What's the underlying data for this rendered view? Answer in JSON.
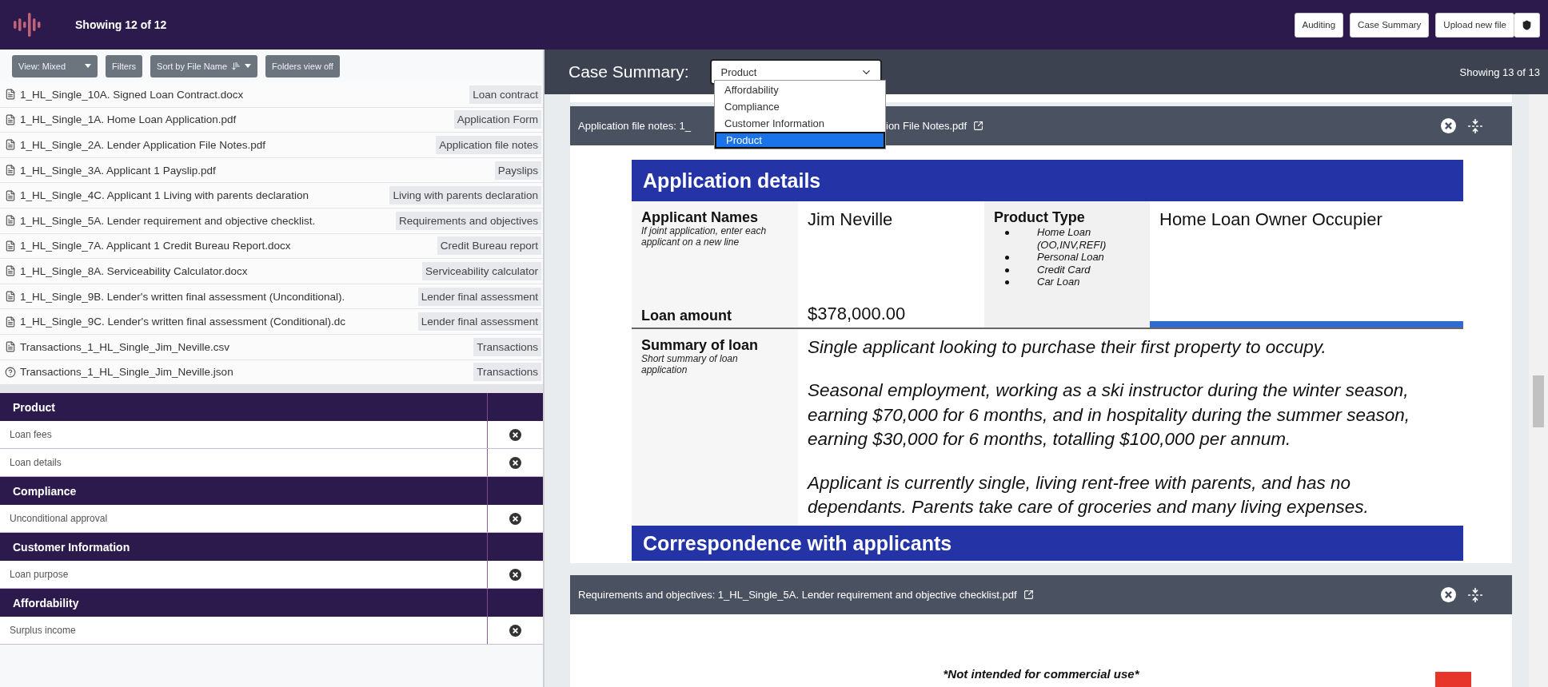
{
  "app_bar": {
    "showing": "Showing 12 of 12",
    "buttons": [
      "Auditing",
      "Case Summary",
      "Upload new file"
    ]
  },
  "toolbar": [
    {
      "label": "View: Mixed",
      "kind": "dropdown"
    },
    {
      "label": "Filters",
      "kind": "button"
    },
    {
      "label": "Sort by File Name",
      "kind": "sort"
    },
    {
      "label": "Folders view off",
      "kind": "button"
    }
  ],
  "files": [
    {
      "name": "1_HL_Single_10A. Signed Loan Contract.docx",
      "kind": "file",
      "tag": "Loan contract"
    },
    {
      "name": "1_HL_Single_1A. Home Loan Application.pdf",
      "kind": "file",
      "tag": "Application Form"
    },
    {
      "name": "1_HL_Single_2A. Lender Application File Notes.pdf",
      "kind": "file",
      "tag": "Application file notes"
    },
    {
      "name": "1_HL_Single_3A. Applicant 1 Payslip.pdf",
      "kind": "file",
      "tag": "Payslips"
    },
    {
      "name": "1_HL_Single_4C. Applicant 1 Living with parents declaration",
      "kind": "file",
      "tag": "Living with parents declaration"
    },
    {
      "name": "1_HL_Single_5A. Lender requirement and objective checklist.",
      "kind": "file",
      "tag": "Requirements and objectives"
    },
    {
      "name": "1_HL_Single_7A. Applicant 1 Credit Bureau Report.docx",
      "kind": "file",
      "tag": "Credit Bureau report"
    },
    {
      "name": "1_HL_Single_8A. Serviceability Calculator.docx",
      "kind": "file",
      "tag": "Serviceability calculator"
    },
    {
      "name": "1_HL_Single_9B. Lender's written final assessment (Unconditional).",
      "kind": "file",
      "tag": "Lender final assessment"
    },
    {
      "name": "1_HL_Single_9C. Lender's written final assessment (Conditional).dc",
      "kind": "file",
      "tag": "Lender final assessment"
    },
    {
      "name": "Transactions_1_HL_Single_Jim_Neville.csv",
      "kind": "file",
      "tag": "Transactions"
    },
    {
      "name": "Transactions_1_HL_Single_Jim_Neville.json",
      "kind": "unknown",
      "tag": "Transactions"
    }
  ],
  "categories": [
    {
      "name": "Product",
      "items": [
        "Loan fees",
        "Loan details"
      ]
    },
    {
      "name": "Compliance",
      "items": [
        "Unconditional approval"
      ]
    },
    {
      "name": "Customer Information",
      "items": [
        "Loan purpose"
      ]
    },
    {
      "name": "Affordability",
      "items": [
        "Surplus income"
      ]
    }
  ],
  "case_summary": {
    "label": "Case Summary:",
    "select": {
      "value": "Product",
      "expanded": true,
      "options": [
        {
          "label": "Affordability",
          "selected": false
        },
        {
          "label": "Compliance",
          "selected": false
        },
        {
          "label": "Customer Information",
          "selected": false
        },
        {
          "label": "Product",
          "selected": true
        }
      ]
    },
    "showing": "Showing 13 of 13"
  },
  "documents": [
    {
      "kind": "application_form",
      "title_start": "Application file notes: 1_",
      "title_end": "ion File Notes.pdf",
      "form": {
        "section_title": "Application details",
        "applicant_label": "Applicant Names",
        "applicant_hint": "If joint application, enter each applicant on a new line",
        "applicant_value": "Jim Neville",
        "product_label": "Product Type",
        "product_options": [
          "Home Loan (OO,INV,REFI)",
          "Personal Loan",
          "Credit Card",
          "Car Loan"
        ],
        "product_value": "Home Loan Owner Occupier",
        "amount_label": "Loan amount",
        "amount_value": "$378,000.00",
        "summary_label": "Summary of loan",
        "summary_hint": "Short summary of loan application",
        "summary_paragraphs": [
          "Single applicant looking to purchase their first property to occupy.",
          "Seasonal employment, working as a ski instructor during the winter season, earning $70,000 for 6 months, and in hospitality during the summer season, earning $30,000 for 6 months, totalling $100,000 per annum.",
          "Applicant is currently single, living rent-free with parents, and has no dependants. Parents take care of groceries and many living expenses."
        ],
        "next_section": "Correspondence with applicants"
      }
    },
    {
      "kind": "notice",
      "title_start": "Requirements and objectives: 1_HL_Single_5A. Lender requirement and objective checklist.pdf",
      "notice": "*Not intended for commercial use*"
    }
  ]
}
